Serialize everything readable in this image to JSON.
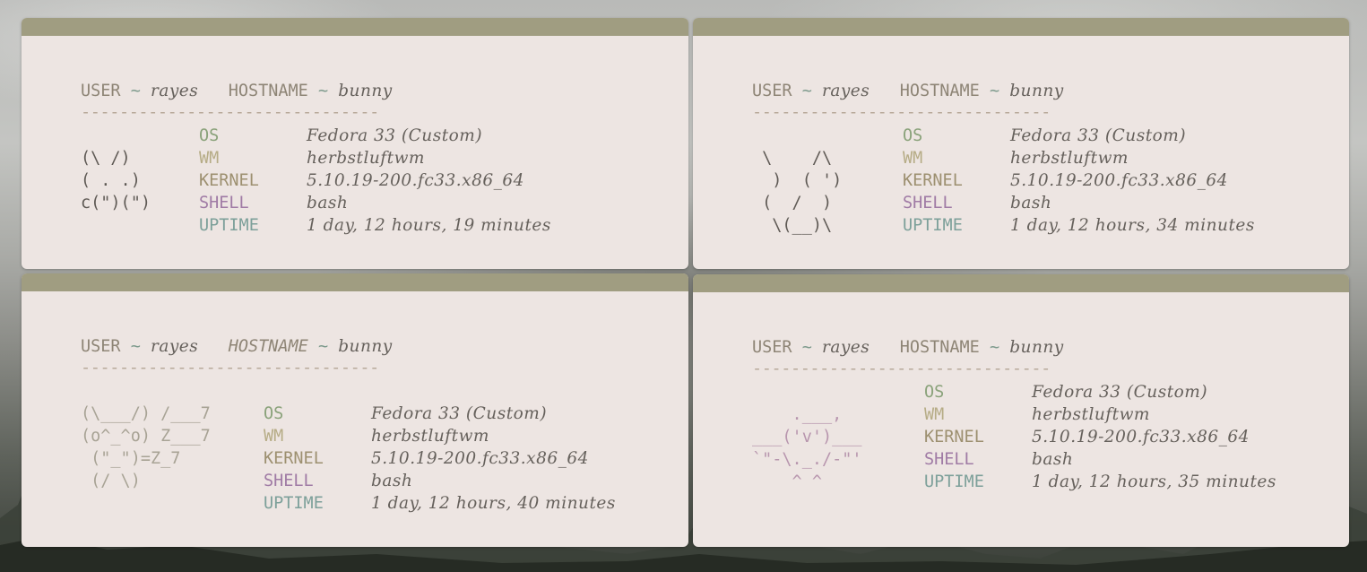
{
  "windows": [
    {
      "user_key": "USER",
      "user_val": "rayes",
      "host_key": "HOSTNAME",
      "host_val": "bunny",
      "separator": "-------------------------------",
      "art": [
        "(\\ /)",
        "( . .)",
        "c(\")(\")"
      ],
      "info": {
        "os_key": "OS",
        "os_val": "Fedora 33 (Custom)",
        "wm_key": "WM",
        "wm_val": "herbstluftwm",
        "kernel_key": "KERNEL",
        "kernel_val": "5.10.19-200.fc33.x86_64",
        "shell_key": "SHELL",
        "shell_val": "bash",
        "uptime_key": "UPTIME",
        "uptime_val": "1 day, 12 hours, 19 minutes"
      }
    },
    {
      "user_key": "USER",
      "user_val": "rayes",
      "host_key": "HOSTNAME",
      "host_val": "bunny",
      "separator": "-------------------------------",
      "art": [
        " \\    /\\",
        "  )  ( ')",
        " (  /  )",
        "  \\(__)\\"
      ],
      "info": {
        "os_key": "OS",
        "os_val": "Fedora 33 (Custom)",
        "wm_key": "WM",
        "wm_val": "herbstluftwm",
        "kernel_key": "KERNEL",
        "kernel_val": "5.10.19-200.fc33.x86_64",
        "shell_key": "SHELL",
        "shell_val": "bash",
        "uptime_key": "UPTIME",
        "uptime_val": "1 day, 12 hours, 34 minutes"
      }
    },
    {
      "user_key": "USER",
      "user_val": "rayes",
      "host_key": "HOSTNAME",
      "host_val": "bunny",
      "separator": "-------------------------------",
      "art": [
        "(\\___/) /___7",
        "(o^_^o) Z___7",
        " (\"_\")=Z_7",
        " (/ \\)"
      ],
      "info": {
        "os_key": "OS",
        "os_val": "Fedora 33 (Custom)",
        "wm_key": "WM",
        "wm_val": "herbstluftwm",
        "kernel_key": "KERNEL",
        "kernel_val": "5.10.19-200.fc33.x86_64",
        "shell_key": "SHELL",
        "shell_val": "bash",
        "uptime_key": "UPTIME",
        "uptime_val": "1 day, 12 hours, 40 minutes"
      }
    },
    {
      "user_key": "USER",
      "user_val": "rayes",
      "host_key": "HOSTNAME",
      "host_val": "bunny",
      "separator": "-------------------------------",
      "art": [
        "    .___,",
        "___('v')___",
        "`\"-\\._./-\"'",
        "    ^ ^"
      ],
      "info": {
        "os_key": "OS",
        "os_val": "Fedora 33 (Custom)",
        "wm_key": "WM",
        "wm_val": "herbstluftwm",
        "kernel_key": "KERNEL",
        "kernel_val": "5.10.19-200.fc33.x86_64",
        "shell_key": "SHELL",
        "shell_val": "bash",
        "uptime_key": "UPTIME",
        "uptime_val": "1 day, 12 hours, 35 minutes"
      }
    }
  ]
}
